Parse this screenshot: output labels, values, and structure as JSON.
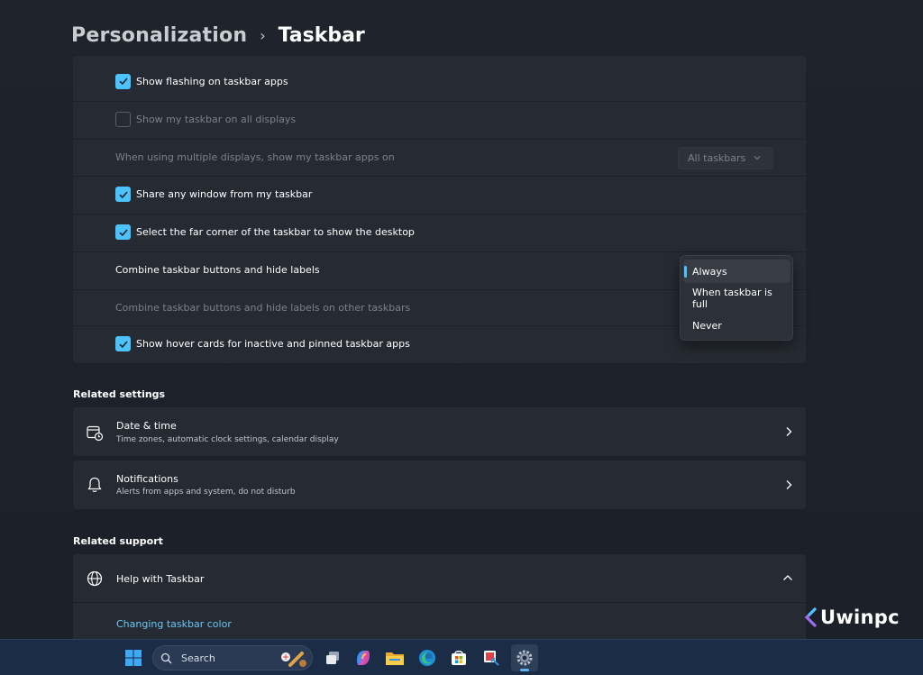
{
  "breadcrumb": {
    "parent": "Personalization",
    "separator": "›",
    "current": "Taskbar"
  },
  "taskbar_behaviors": [
    {
      "label": "Show flashing on taskbar apps",
      "checked": true,
      "enabled": true
    },
    {
      "label": "Show my taskbar on all displays",
      "checked": false,
      "enabled": false
    },
    {
      "label": "When using multiple displays, show my taskbar apps on",
      "dropdown_value": "All taskbars",
      "enabled": false
    },
    {
      "label": "Share any window from my taskbar",
      "checked": true,
      "enabled": true
    },
    {
      "label": "Select the far corner of the taskbar to show the desktop",
      "checked": true,
      "enabled": true
    },
    {
      "label": "Combine taskbar buttons and hide labels",
      "enabled": true
    },
    {
      "label": "Combine taskbar buttons and hide labels on other taskbars",
      "enabled": false
    },
    {
      "label": "Show hover cards for inactive and pinned taskbar apps",
      "checked": true,
      "enabled": true
    }
  ],
  "combine_menu": {
    "options": [
      "Always",
      "When taskbar is full",
      "Never"
    ],
    "selected": "Always"
  },
  "related_settings": {
    "heading": "Related settings",
    "items": [
      {
        "title": "Date & time",
        "subtitle": "Time zones, automatic clock settings, calendar display",
        "icon": "calendar-clock-icon"
      },
      {
        "title": "Notifications",
        "subtitle": "Alerts from apps and system, do not disturb",
        "icon": "bell-icon"
      }
    ]
  },
  "related_support": {
    "heading": "Related support",
    "item": {
      "title": "Help with Taskbar",
      "icon": "globe-icon",
      "expanded": true
    },
    "link": "Changing taskbar color"
  },
  "watermark": "Uwinpc",
  "taskbar": {
    "search_label": "Search",
    "apps": [
      "start-icon",
      "task-view-icon",
      "copilot-icon",
      "file-explorer-icon",
      "edge-icon",
      "store-icon",
      "snipping-tool-icon",
      "settings-icon"
    ]
  },
  "colors": {
    "accent": "#4cc2ff",
    "link": "#6cc6f5",
    "card": "#262a32",
    "background": "#1d2129"
  }
}
